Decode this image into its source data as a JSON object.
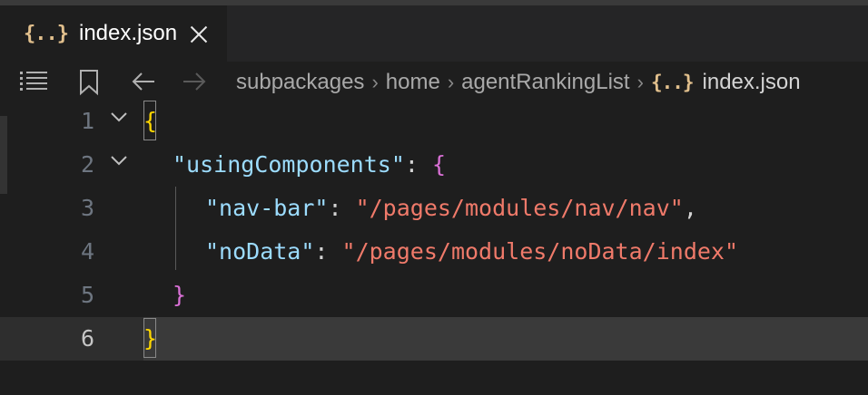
{
  "tab": {
    "icon": "{..}",
    "title": "index.json"
  },
  "toolbar": {
    "icons": [
      "list-icon",
      "bookmark-icon",
      "back-arrow-icon",
      "forward-arrow-icon"
    ]
  },
  "breadcrumb": {
    "items": [
      "subpackages",
      "home",
      "agentRankingList"
    ],
    "file_icon": "{..}",
    "file": "index.json"
  },
  "editor": {
    "lines": [
      {
        "num": "1",
        "text": "{"
      },
      {
        "num": "2",
        "key": "\"usingComponents\"",
        "colon": ": ",
        "brace": "{"
      },
      {
        "num": "3",
        "key": "\"nav-bar\"",
        "colon": ": ",
        "value": "\"/pages/modules/nav/nav\"",
        "tail": ","
      },
      {
        "num": "4",
        "key": "\"noData\"",
        "colon": ": ",
        "value": "\"/pages/modules/noData/index\""
      },
      {
        "num": "5",
        "text": "}"
      },
      {
        "num": "6",
        "text": "}"
      }
    ],
    "current_line": "6"
  },
  "colors": {
    "background": "#1e1e1e",
    "key": "#9cdcfe",
    "string": "#f07a6a",
    "brace_outer": "#ffd700",
    "brace_inner": "#da70d6"
  }
}
